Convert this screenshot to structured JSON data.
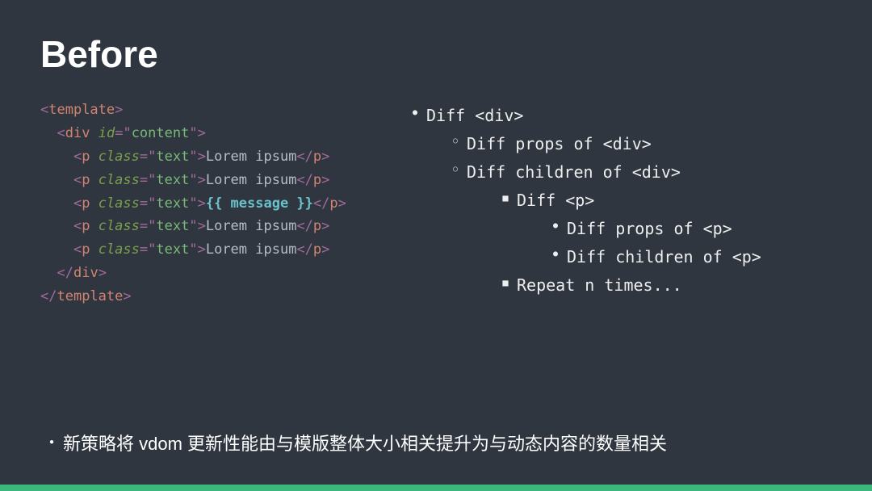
{
  "title": "Before",
  "code": {
    "lines": [
      {
        "indent": 0,
        "open": true,
        "tag": "template",
        "attrs": [],
        "content": null,
        "selfcontained": false
      },
      {
        "indent": 1,
        "open": true,
        "tag": "div",
        "attrs": [
          [
            "id",
            "content"
          ]
        ],
        "content": null,
        "selfcontained": false
      },
      {
        "indent": 2,
        "open": true,
        "tag": "p",
        "attrs": [
          [
            "class",
            "text"
          ]
        ],
        "content": "Lorem ipsum",
        "expr": false,
        "selfcontained": true
      },
      {
        "indent": 2,
        "open": true,
        "tag": "p",
        "attrs": [
          [
            "class",
            "text"
          ]
        ],
        "content": "Lorem ipsum",
        "expr": false,
        "selfcontained": true
      },
      {
        "indent": 2,
        "open": true,
        "tag": "p",
        "attrs": [
          [
            "class",
            "text"
          ]
        ],
        "content": "{{ message }}",
        "expr": true,
        "selfcontained": true
      },
      {
        "indent": 2,
        "open": true,
        "tag": "p",
        "attrs": [
          [
            "class",
            "text"
          ]
        ],
        "content": "Lorem ipsum",
        "expr": false,
        "selfcontained": true
      },
      {
        "indent": 2,
        "open": true,
        "tag": "p",
        "attrs": [
          [
            "class",
            "text"
          ]
        ],
        "content": "Lorem ipsum",
        "expr": false,
        "selfcontained": true
      },
      {
        "indent": 1,
        "open": false,
        "tag": "div",
        "attrs": [],
        "content": null,
        "selfcontained": false
      },
      {
        "indent": 0,
        "open": false,
        "tag": "template",
        "attrs": [],
        "content": null,
        "selfcontained": false
      }
    ]
  },
  "bullets": {
    "l1": "Diff <div>",
    "l2a": "Diff props of <div>",
    "l2b": "Diff children of <div>",
    "l3a": "Diff <p>",
    "l4a": "Diff props of <p>",
    "l4b": "Diff children of <p>",
    "l3b": "Repeat n times..."
  },
  "footer": "新策略将 vdom 更新性能由与模版整体大小相关提升为与动态内容的数量相关",
  "glyphs": {
    "disc": "●",
    "circle": "○",
    "square": "■"
  }
}
